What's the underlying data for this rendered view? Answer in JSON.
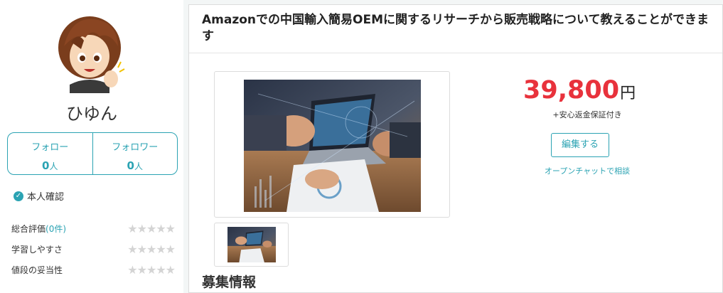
{
  "profile": {
    "name": "ひゆん",
    "follow_label": "フォロー",
    "follow_count": "0",
    "follower_label": "フォロワー",
    "follower_count": "0",
    "count_unit": "人",
    "verified_label": "本人確認"
  },
  "ratings": [
    {
      "label": "総合評価",
      "count": "(0件)",
      "stars": 0
    },
    {
      "label": "学習しやすさ",
      "count": "",
      "stars": 0
    },
    {
      "label": "値段の妥当性",
      "count": "",
      "stars": 0
    }
  ],
  "listing": {
    "title": "Amazonでの中国輸入簡易OEMに関するリサーチから販売戦略について教えることができます",
    "price": "39,800",
    "currency": "円",
    "guarantee": "+安心返金保証付き",
    "edit_label": "編集する",
    "chat_label": "オープンチャットで相談",
    "section_title": "募集情報"
  },
  "colors": {
    "accent": "#2ba3b3",
    "price": "#e8323c"
  }
}
